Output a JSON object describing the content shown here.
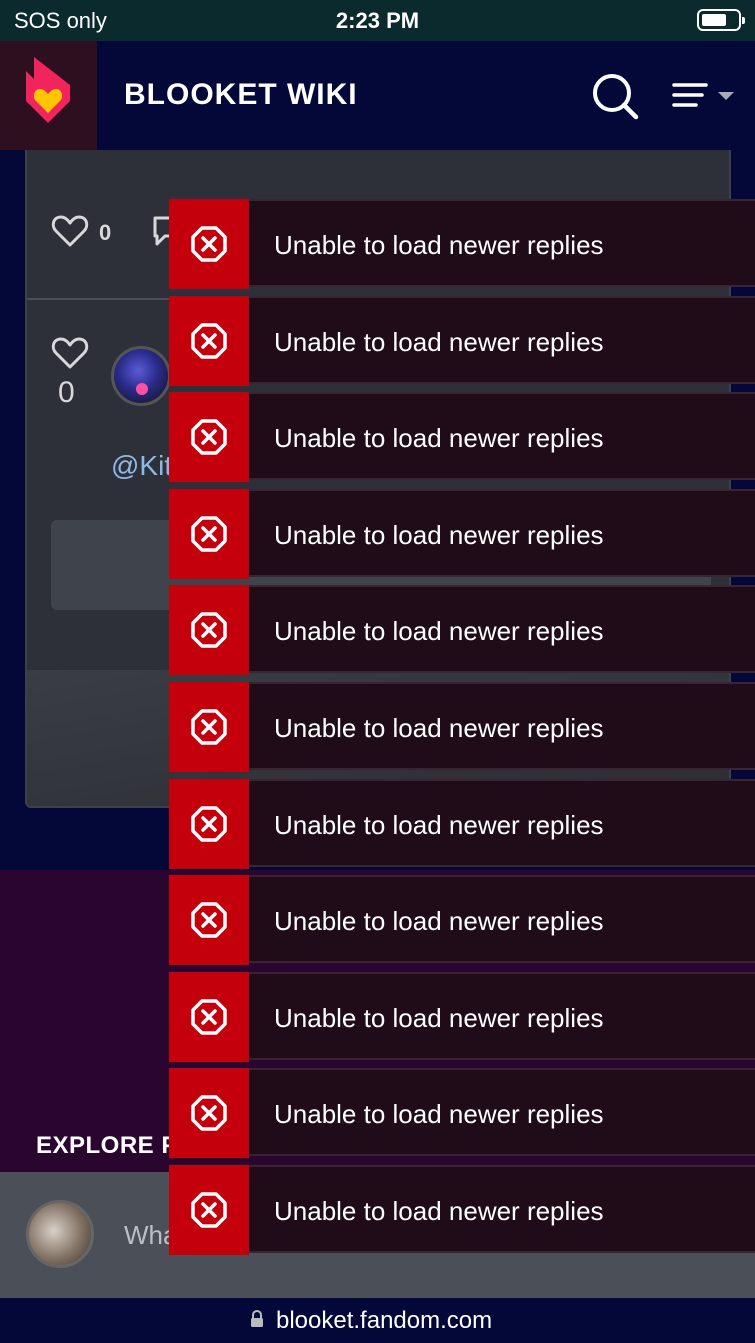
{
  "status_bar": {
    "carrier": "SOS only",
    "time": "2:23 PM",
    "battery_level": 0.7
  },
  "header": {
    "title": "BLOOKET WIKI",
    "logo_icon": "fandom-flame-heart-icon",
    "search_icon": "search-icon",
    "menu_icon": "menu-lines-icon",
    "brand_colors": {
      "flame": "#f2245d",
      "heart": "#ffc500",
      "background": "#040838"
    }
  },
  "comment": {
    "like_count": "0",
    "reply": {
      "like_count": "0",
      "mention_text": "@Kit"
    }
  },
  "explore": {
    "title": "EXPLORE P"
  },
  "composer": {
    "placeholder": "Wha"
  },
  "url_bar": {
    "domain": "blooket.fandom.com"
  },
  "toasts": [
    {
      "message": "Unable to load newer replies",
      "icon": "error-x-octagon-icon"
    },
    {
      "message": "Unable to load newer replies",
      "icon": "error-x-octagon-icon"
    },
    {
      "message": "Unable to load newer replies",
      "icon": "error-x-octagon-icon"
    },
    {
      "message": "Unable to load newer replies",
      "icon": "error-x-octagon-icon"
    },
    {
      "message": "Unable to load newer replies",
      "icon": "error-x-octagon-icon"
    },
    {
      "message": "Unable to load newer replies",
      "icon": "error-x-octagon-icon"
    },
    {
      "message": "Unable to load newer replies",
      "icon": "error-x-octagon-icon"
    },
    {
      "message": "Unable to load newer replies",
      "icon": "error-x-octagon-icon"
    },
    {
      "message": "Unable to load newer replies",
      "icon": "error-x-octagon-icon"
    },
    {
      "message": "Unable to load newer replies",
      "icon": "error-x-octagon-icon"
    },
    {
      "message": "Unable to load newer replies",
      "icon": "error-x-octagon-icon"
    }
  ],
  "toast_color": "#c4000c"
}
